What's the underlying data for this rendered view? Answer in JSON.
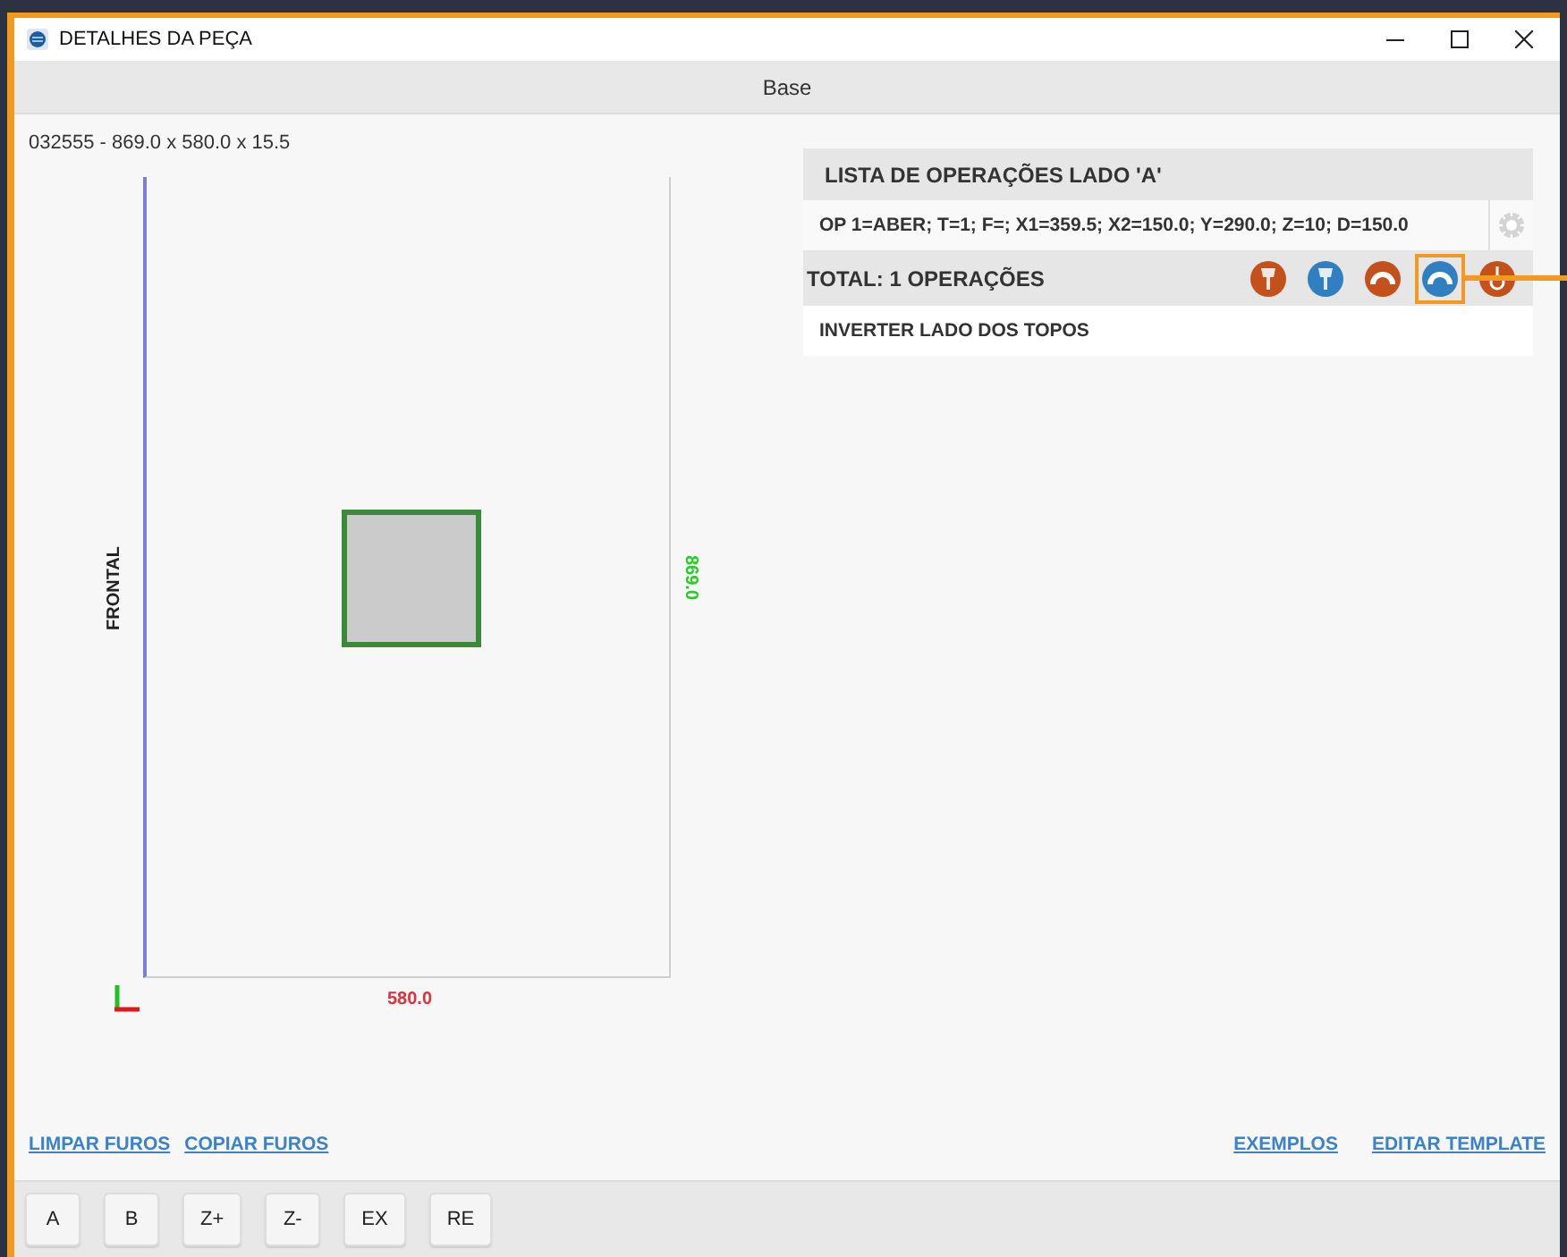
{
  "window": {
    "title": "DETALHES DA PEÇA"
  },
  "tab_bar": {
    "label": "Base"
  },
  "piece": {
    "dimensions": "032555 - 869.0 x 580.0 x 15.5",
    "side_label": "FRONTAL",
    "height_label": "869.0",
    "width_label": "580.0"
  },
  "operations_panel": {
    "title": "LISTA DE OPERAÇÕES LADO 'A'",
    "operations": [
      {
        "text": "OP 1=ABER; T=1; F=; X1=359.5; X2=150.0; Y=290.0; Z=10; D=150.0"
      }
    ],
    "total": "TOTAL: 1 OPERAÇÕES",
    "tools": [
      {
        "kind": "bit",
        "color": "#c4511c",
        "highlighted": false
      },
      {
        "kind": "bit",
        "color": "#2f7fc1",
        "highlighted": false
      },
      {
        "kind": "dome",
        "color": "#c4511c",
        "highlighted": false
      },
      {
        "kind": "dome",
        "color": "#2f7fc1",
        "highlighted": true
      },
      {
        "kind": "ring",
        "color": "#c4511c",
        "highlighted": false
      }
    ],
    "option": "INVERTER LADO DOS TOPOS"
  },
  "links_left": [
    "LIMPAR FUROS",
    "COPIAR FUROS"
  ],
  "links_right": [
    "EXEMPLOS",
    "EDITAR TEMPLATE"
  ],
  "buttons": [
    "A",
    "B",
    "Z+",
    "Z-",
    "EX",
    "RE"
  ]
}
